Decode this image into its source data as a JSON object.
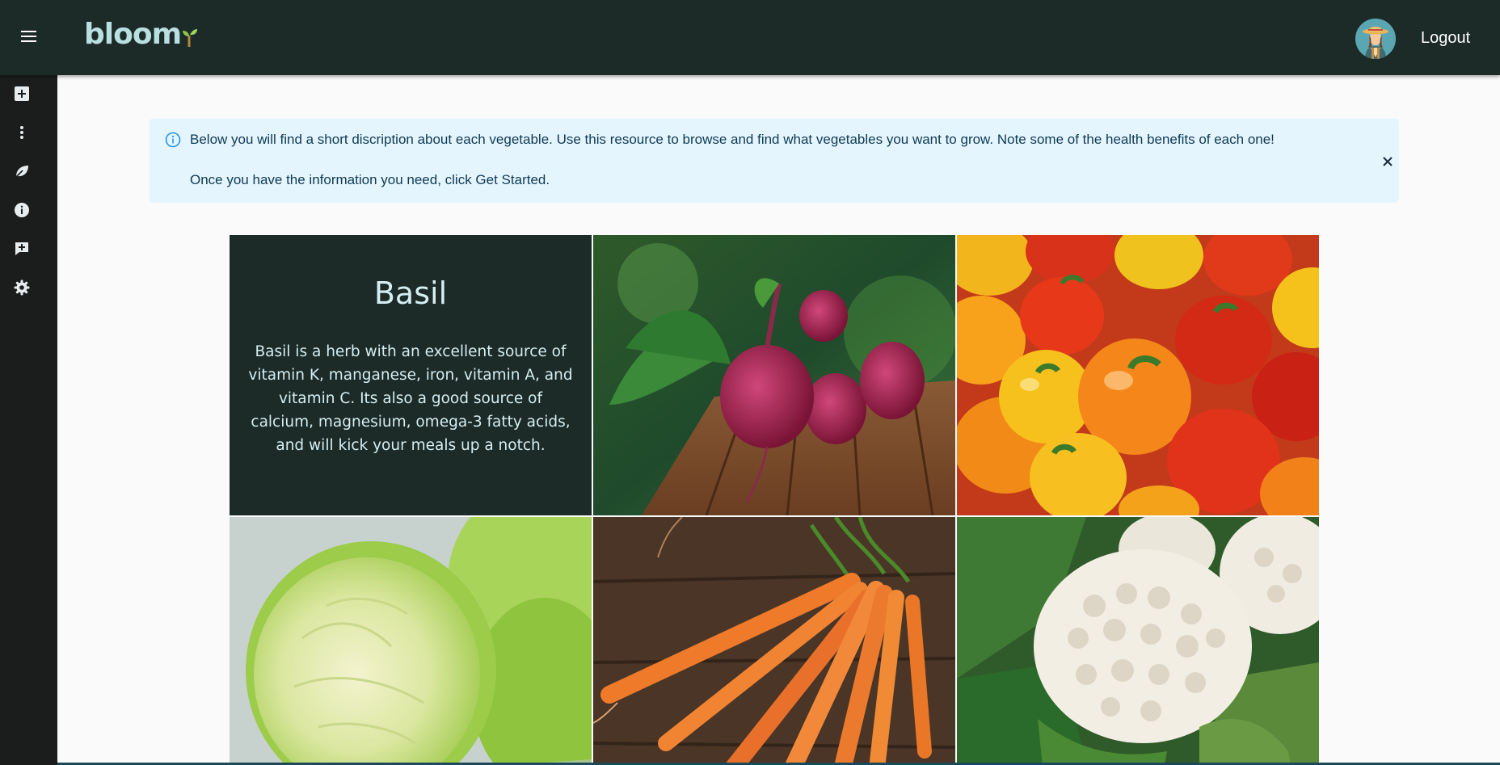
{
  "app": {
    "logo_text": "bloom",
    "logout_label": "Logout"
  },
  "sidebar": {
    "items": [
      {
        "icon": "add-box-icon"
      },
      {
        "icon": "more-vert-icon"
      },
      {
        "icon": "leaf-icon"
      },
      {
        "icon": "info-icon"
      },
      {
        "icon": "add-comment-icon"
      },
      {
        "icon": "settings-icon"
      }
    ]
  },
  "alert": {
    "line1": "Below you will find a short discription about each vegetable. Use this resource to browse and find what vegetables you want to grow. Note some of the health benefits of each one!",
    "line2": "Once you have the information you need, click Get Started."
  },
  "tiles": [
    {
      "type": "info",
      "title": "Basil",
      "description": "Basil is a herb with an excellent source of vitamin K, manganese, iron, vitamin A, and vitamin C. Its also a good source of calcium, magnesium, omega-3 fatty acids, and will kick your meals up a notch."
    },
    {
      "type": "image",
      "image": "beets-photo"
    },
    {
      "type": "image",
      "image": "bell-peppers-photo"
    },
    {
      "type": "image",
      "image": "cabbage-photo"
    },
    {
      "type": "image",
      "image": "carrots-photo"
    },
    {
      "type": "image",
      "image": "cauliflower-photo"
    }
  ],
  "colors": {
    "appbar": "#1c2a28",
    "sidebar": "#1b1c1c",
    "logo": "#b9dfe0",
    "alert_bg": "#e5f5fd",
    "alert_text": "#0e3a55"
  }
}
